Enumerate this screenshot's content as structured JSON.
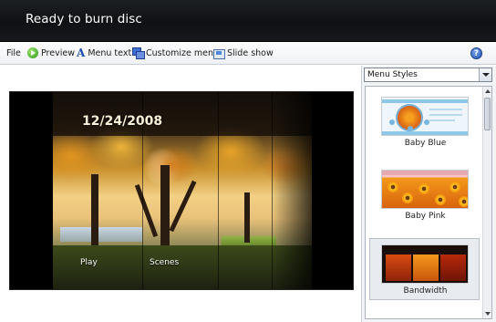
{
  "window": {
    "title": "Ready to burn disc"
  },
  "toolbar": {
    "file": "File",
    "preview": "Preview",
    "menu_text": "Menu text",
    "customize_menu": "Customize menu",
    "slide_show": "Slide show",
    "help_icon": "question-mark-icon"
  },
  "preview": {
    "date": "12/24/2008",
    "menu_items": [
      "Play",
      "Scenes"
    ]
  },
  "menu_styles": {
    "dropdown_value": "Menu Styles",
    "items": [
      {
        "label": "Baby Blue",
        "selected": false
      },
      {
        "label": "Baby Pink",
        "selected": false
      },
      {
        "label": "Bandwidth",
        "selected": true
      }
    ]
  },
  "colors": {
    "title_bar": "#111316",
    "accent_blue": "#1f4fb3",
    "selection": "#e8ebef"
  }
}
